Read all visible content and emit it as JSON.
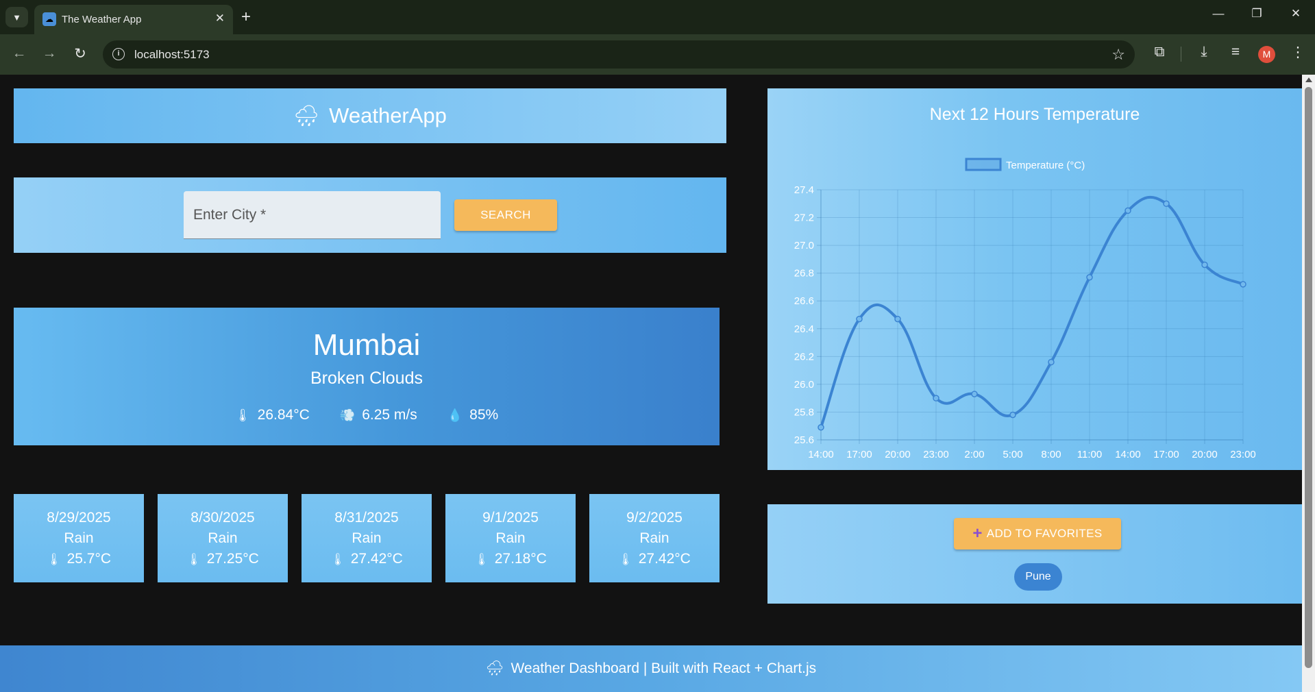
{
  "browser": {
    "tab_title": "The Weather App",
    "url": "localhost:5173",
    "avatar_letter": "M"
  },
  "header": {
    "title": "WeatherApp",
    "icon": "cloud-rain-icon"
  },
  "search": {
    "placeholder": "Enter City *",
    "value": "",
    "button_label": "SEARCH"
  },
  "current": {
    "city": "Mumbai",
    "description": "Broken Clouds",
    "temperature": "26.84°C",
    "wind": "6.25 m/s",
    "humidity": "85%"
  },
  "forecast": [
    {
      "date": "8/29/2025",
      "condition": "Rain",
      "temp": "25.7°C"
    },
    {
      "date": "8/30/2025",
      "condition": "Rain",
      "temp": "27.25°C"
    },
    {
      "date": "8/31/2025",
      "condition": "Rain",
      "temp": "27.42°C"
    },
    {
      "date": "9/1/2025",
      "condition": "Rain",
      "temp": "27.18°C"
    },
    {
      "date": "9/2/2025",
      "condition": "Rain",
      "temp": "27.42°C"
    }
  ],
  "chart_data": {
    "type": "line",
    "title": "Next 12 Hours Temperature",
    "categories": [
      "14:00",
      "17:00",
      "20:00",
      "23:00",
      "2:00",
      "5:00",
      "8:00",
      "11:00",
      "14:00",
      "17:00",
      "20:00",
      "23:00"
    ],
    "series": [
      {
        "name": "Temperature (°C)",
        "values": [
          25.69,
          26.47,
          26.47,
          25.9,
          25.93,
          25.78,
          26.16,
          26.77,
          27.25,
          27.3,
          26.86,
          26.72
        ]
      }
    ],
    "yticks": [
      25.6,
      25.8,
      26.0,
      26.2,
      26.4,
      26.6,
      26.8,
      27.0,
      27.2,
      27.4
    ],
    "ylim": [
      25.6,
      27.4
    ],
    "grid": true,
    "legend": "top",
    "line_color": "#3b84d2"
  },
  "favorites": {
    "button_label": "ADD TO FAVORITES",
    "items": [
      "Pune"
    ]
  },
  "footer": {
    "text": "Weather Dashboard | Built with React + Chart.js"
  },
  "colors": {
    "accent": "#f5b95b",
    "primary": "#3b84d2",
    "panel": "#7ac4f2",
    "background": "#121212"
  }
}
